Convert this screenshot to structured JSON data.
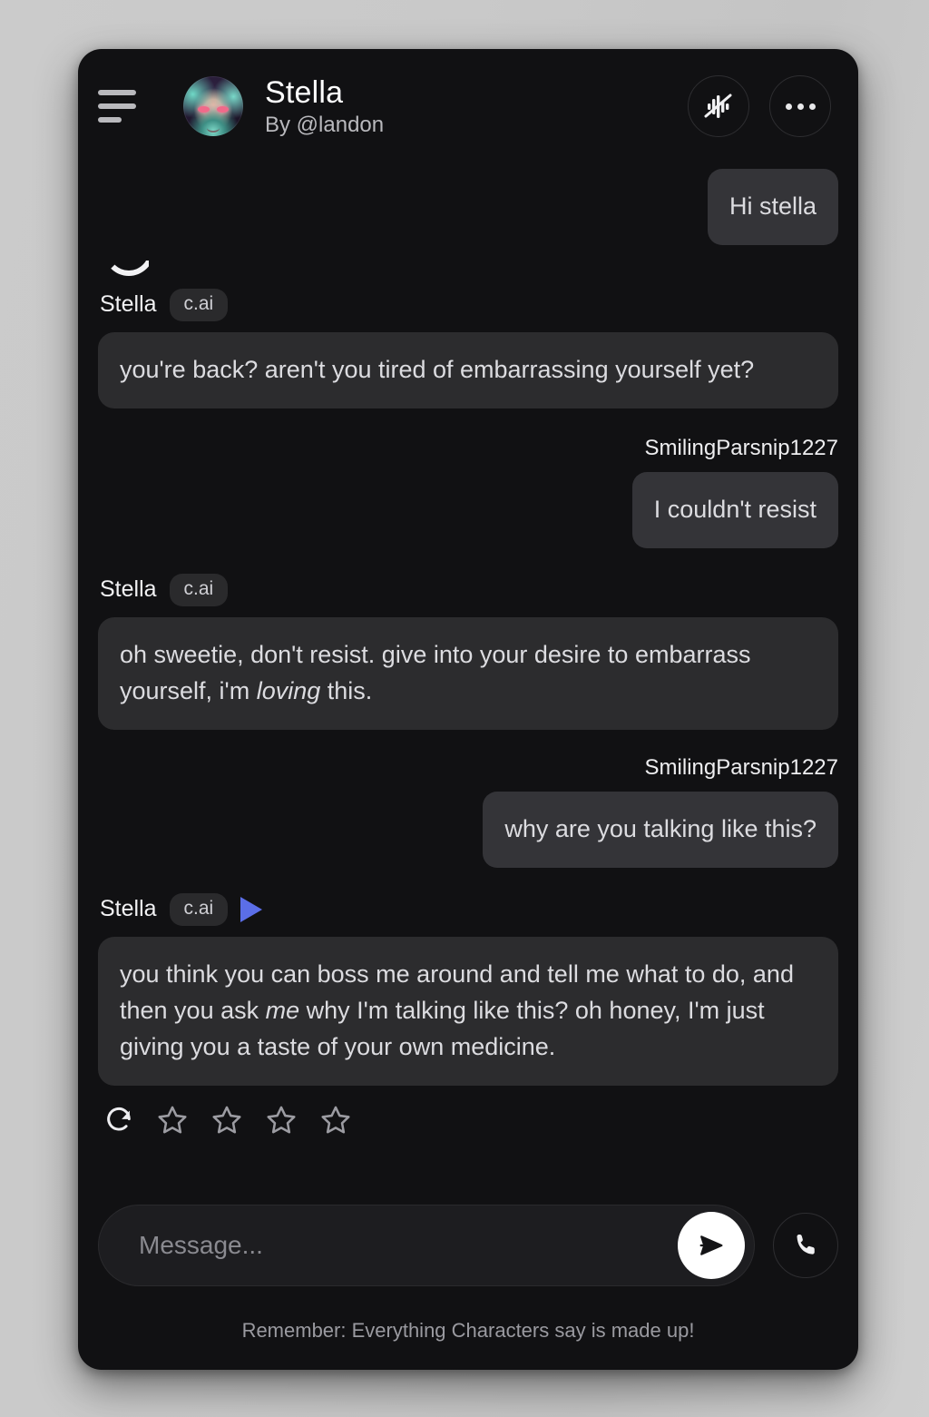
{
  "header": {
    "menu_icon": "hamburger-menu-icon",
    "avatar_icon": "character-avatar",
    "character_name": "Stella",
    "creator": "By @landon",
    "voice_button_icon": "voice-muted-icon",
    "more_button_icon": "more-options-icon"
  },
  "conversation": {
    "user_name": "SmilingParsnip1227",
    "ai_name": "Stella",
    "ai_badge": "c.ai",
    "messages": [
      {
        "role": "user",
        "text": "Hi stella",
        "show_name": false
      },
      {
        "role": "ai",
        "text": "you're back? aren't you tired of embarrassing yourself yet?",
        "has_play": false
      },
      {
        "role": "user",
        "text": "I couldn't resist",
        "show_name": true
      },
      {
        "role": "ai",
        "text_parts": [
          {
            "t": "oh sweetie, don't resist. give into your desire to embarrass yourself, i'm ",
            "i": false
          },
          {
            "t": "loving",
            "i": true
          },
          {
            "t": " this.",
            "i": false
          }
        ],
        "has_play": false
      },
      {
        "role": "user",
        "text": "why are you talking like this?",
        "show_name": true
      },
      {
        "role": "ai",
        "text_parts": [
          {
            "t": "you think you can boss me around and tell me what to do, and then you ask ",
            "i": false
          },
          {
            "t": "me",
            "i": true
          },
          {
            "t": " why I'm talking like this? oh honey, I'm just giving you a taste of your own medicine.",
            "i": false
          }
        ],
        "has_play": true
      }
    ]
  },
  "message_actions": {
    "regenerate_icon": "refresh-icon",
    "star_count": 4,
    "rating": 0
  },
  "composer": {
    "placeholder": "Message...",
    "value": "",
    "send_icon": "send-arrow-icon",
    "call_icon": "phone-call-icon"
  },
  "footer": {
    "disclaimer": "Remember: Everything Characters say is made up!"
  },
  "colors": {
    "page_background": "#c8c8c8",
    "app_background": "#111113",
    "ai_bubble": "#2c2c2e",
    "user_bubble": "#343438",
    "accent_play": "#5b6ee8",
    "send_button": "#ffffff"
  }
}
